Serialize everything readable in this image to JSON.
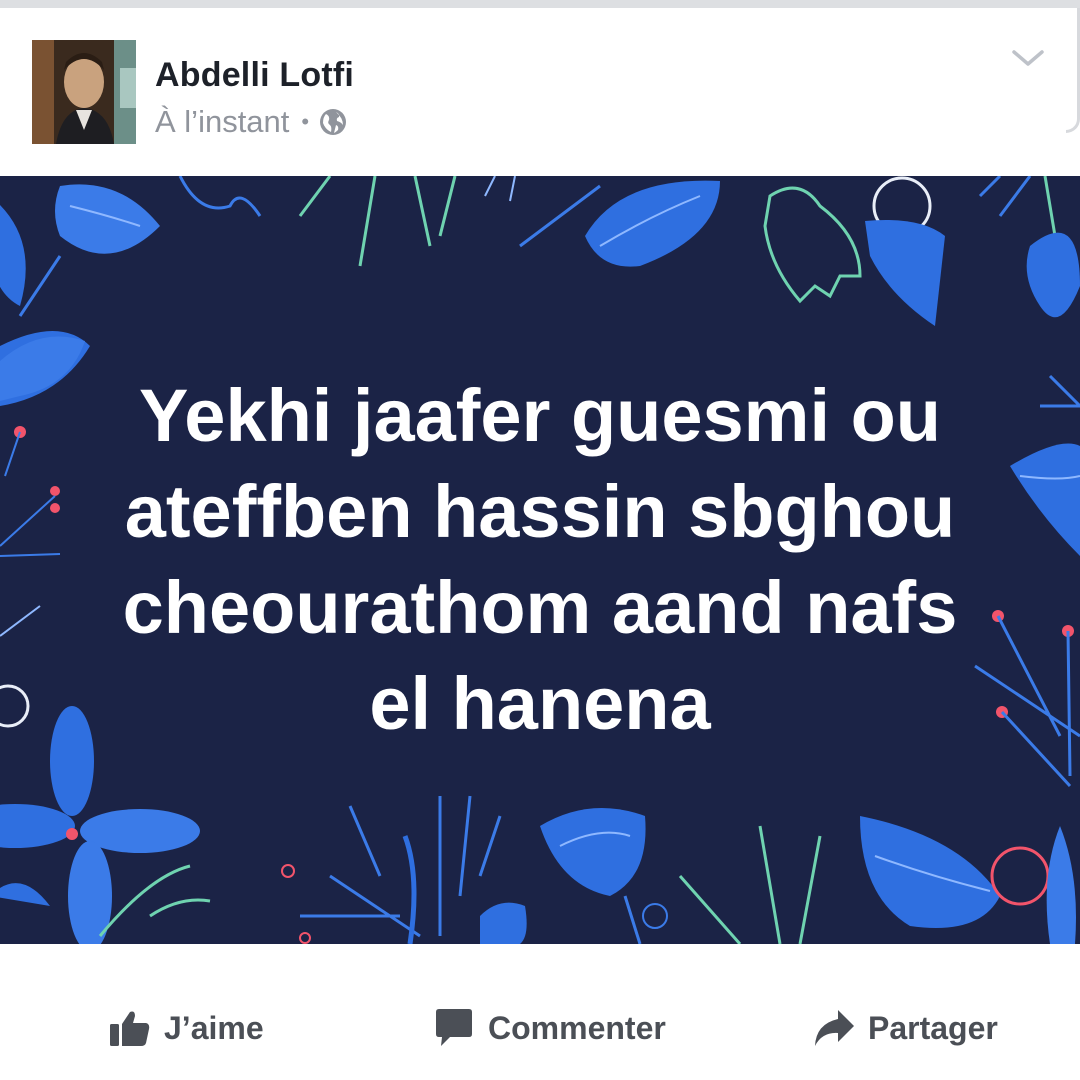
{
  "post": {
    "author": "Abdelli Lotfi",
    "timestamp": "À l’instant",
    "separator": "•",
    "privacy_icon": "globe-icon",
    "menu_icon": "chevron-down-icon",
    "text": "Yekhi jaafer guesmi ou ateffben hassin sbghou cheourathom aand nafs el hanena",
    "background_color": "#1b2346",
    "text_color": "#ffffff"
  },
  "actions": {
    "like_label": "J’aime",
    "comment_label": "Commenter",
    "share_label": "Partager"
  },
  "colors": {
    "author": "#1d2129",
    "meta": "#90949c",
    "action": "#4b4f56",
    "leaf_blue": "#2f6fe0",
    "leaf_light": "#4a8cf0",
    "stroke_green": "#6fd3b0",
    "berry": "#f2546b"
  }
}
